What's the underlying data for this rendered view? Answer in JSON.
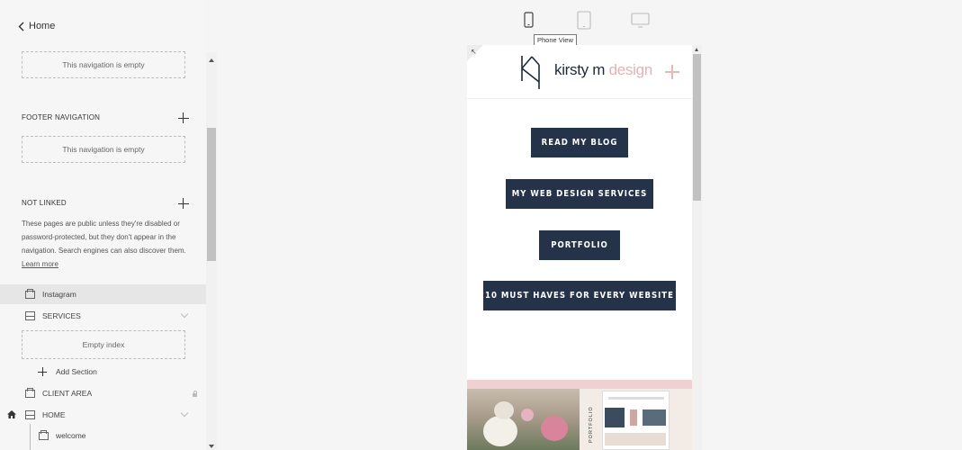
{
  "sidebar": {
    "home_label": "Home",
    "top_empty": "This navigation is empty",
    "footer": {
      "heading": "FOOTER NAVIGATION",
      "empty": "This navigation is empty"
    },
    "not_linked": {
      "heading": "NOT LINKED",
      "description": "These pages are public unless they're disabled or password-protected, but they don't appear in the navigation. Search engines can also discover them.",
      "learn_more": "Learn more"
    },
    "pages": [
      {
        "label": "Instagram",
        "icon": "page-icon",
        "highlighted": true
      },
      {
        "label": "SERVICES",
        "icon": "index-icon"
      },
      {
        "label": "CLIENT AREA",
        "icon": "page-icon",
        "locked": true
      },
      {
        "label": "HOME",
        "icon": "index-icon",
        "is_homepage": true
      },
      {
        "label": "welcome",
        "icon": "page-icon"
      }
    ],
    "empty_index": "Empty index",
    "add_section": "Add Section"
  },
  "toolbar": {
    "devices": [
      "phone-icon",
      "tablet-icon",
      "desktop-icon"
    ],
    "active_device": "phone",
    "tooltip": "Phone View"
  },
  "preview": {
    "logo_name": "kirsty m",
    "logo_accent": "design",
    "buttons": [
      "READ MY BLOG",
      "MY WEB DESIGN SERVICES",
      "PORTFOLIO",
      "10 MUST HAVES FOR EVERY WEBSITE"
    ],
    "portfolio_label": "PORTFOLIO"
  },
  "colors": {
    "navy": "#243349",
    "pink": "#e0b4b4",
    "band": "#f0d0d0"
  }
}
